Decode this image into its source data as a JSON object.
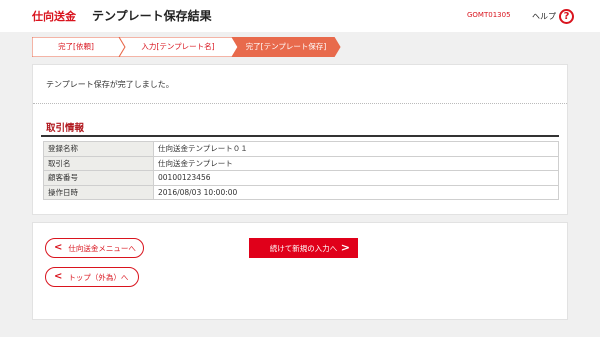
{
  "header": {
    "brand": "仕向送金",
    "title": "テンプレート保存結果",
    "screen_id": "GOMT01305",
    "help_label": "ヘルプ",
    "help_icon": "?"
  },
  "steps": [
    {
      "label": "完了[依頼]",
      "state": "done"
    },
    {
      "label": "入力[テンプレート名]",
      "state": "done"
    },
    {
      "label": "完了[テンプレート保存]",
      "state": "current"
    }
  ],
  "message": "テンプレート保存が完了しました。",
  "section": {
    "title": "取引情報",
    "rows": [
      {
        "label": "登録名称",
        "value": "仕向送金テンプレート０１"
      },
      {
        "label": "取引名",
        "value": "仕向送金テンプレート"
      },
      {
        "label": "顧客番号",
        "value": "00100123456"
      },
      {
        "label": "操作日時",
        "value": "2016/08/03 10:00:00"
      }
    ]
  },
  "actions": {
    "menu_label": "仕向送金メニューへ",
    "top_label": "トップ（外為）へ",
    "continue_label": "続けて新規の入力へ"
  },
  "colors": {
    "accent": "#d9141e",
    "step_current": "#e86a4c",
    "primary_button": "#e0001a",
    "section_title": "#b1181e"
  }
}
